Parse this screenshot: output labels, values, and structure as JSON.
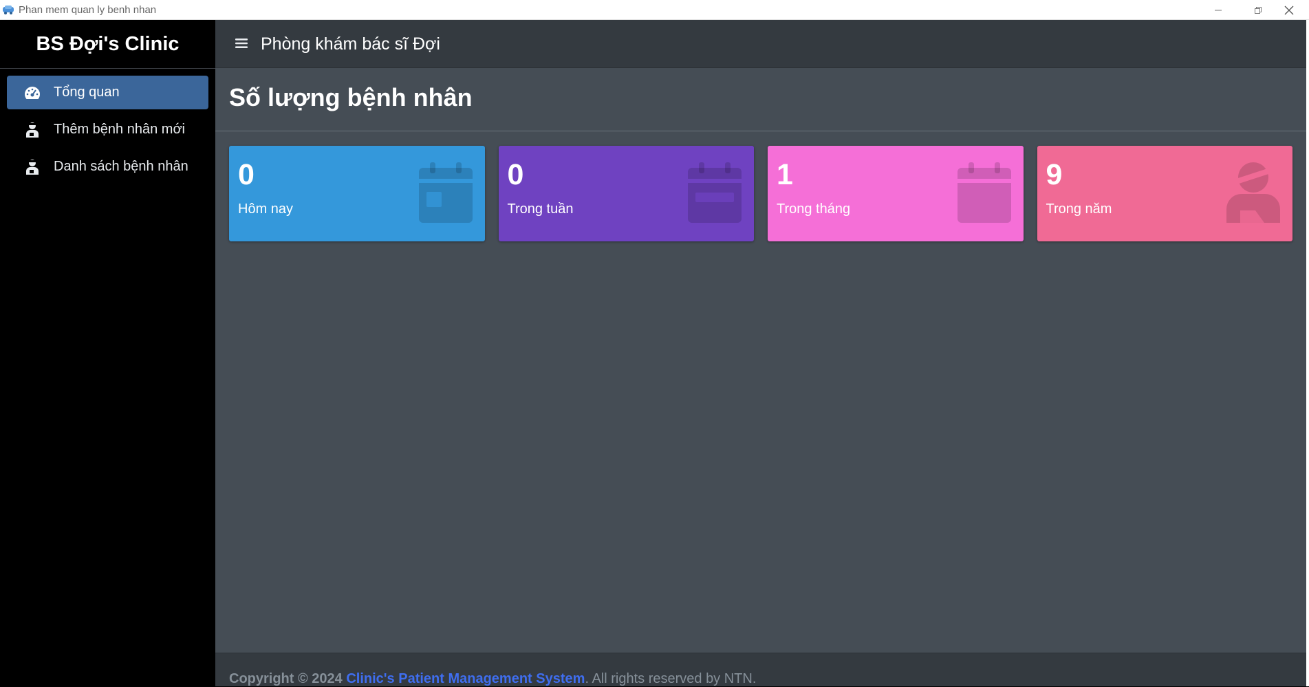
{
  "window": {
    "title": "Phan mem quan ly benh nhan",
    "icon": "car-app-icon",
    "controls": [
      "minimize-icon",
      "restore-icon",
      "close-icon"
    ]
  },
  "sidebar": {
    "brand": "BS Đợi's Clinic",
    "items": [
      {
        "label": "Tổng quan",
        "icon": "gauge-icon",
        "active": true
      },
      {
        "label": "Thêm bệnh nhân mới",
        "icon": "patient-icon",
        "active": false
      },
      {
        "label": "Danh sách bệnh nhân",
        "icon": "patient-icon",
        "active": false
      }
    ]
  },
  "topbar": {
    "menu_icon": "hamburger-icon",
    "heading": "Phòng khám bác sĩ Đợi"
  },
  "content": {
    "title": "Số lượng bệnh nhân",
    "cards": [
      {
        "value": "0",
        "label": "Hôm nay",
        "color": "#3498db",
        "icon": "calendar-day-icon"
      },
      {
        "value": "0",
        "label": "Trong tuần",
        "color": "#6f42c1",
        "icon": "calendar-week-icon"
      },
      {
        "value": "1",
        "label": "Trong tháng",
        "color": "#f56fd7",
        "icon": "calendar-icon"
      },
      {
        "value": "9",
        "label": "Trong năm",
        "color": "#f06a95",
        "icon": "injured-patient-icon"
      }
    ]
  },
  "footer": {
    "prefix": "Copyright © 2024",
    "link": "Clinic's Patient Management System",
    "suffix": ". All rights reserved by NTN."
  },
  "colors": {
    "sidebar_bg": "#000000",
    "active_item": "#3b669a",
    "topbar_bg": "#343a40",
    "content_bg": "#454d55",
    "link": "#3f6ef0"
  }
}
